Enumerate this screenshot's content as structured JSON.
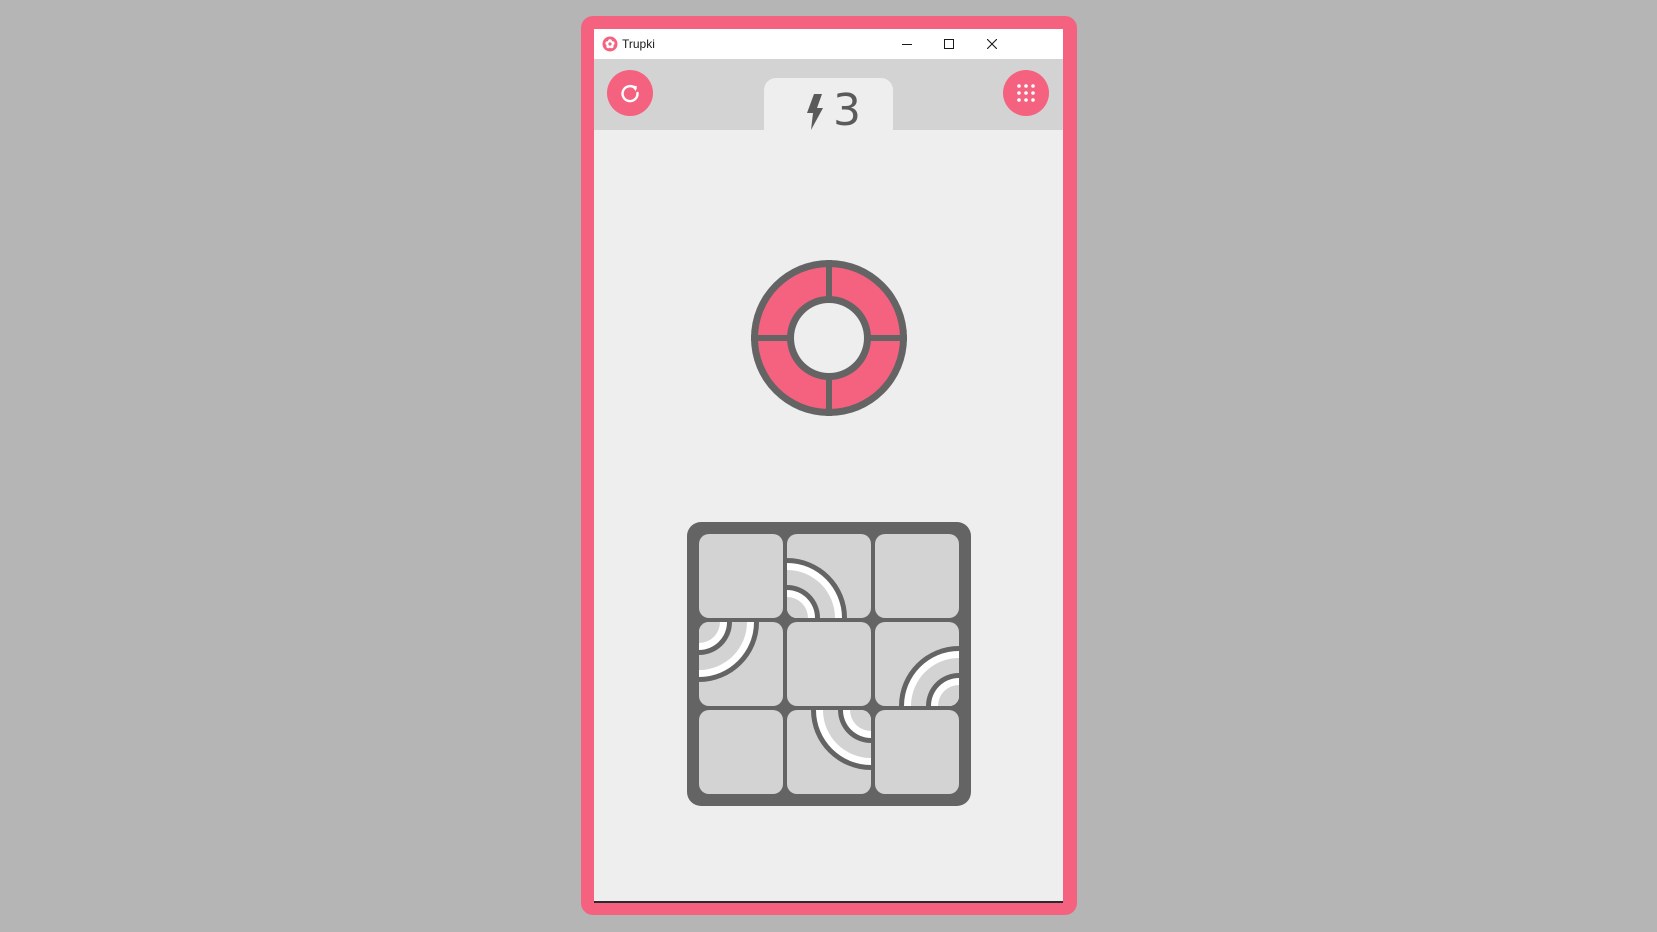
{
  "window": {
    "title": "Trupki",
    "icon": "flower-icon",
    "controls": [
      "minimize-icon",
      "maximize-icon",
      "close-icon"
    ]
  },
  "toolbar": {
    "restart_icon": "restart-icon",
    "menu_icon": "grid-menu-icon",
    "moves_icon": "lightning-icon",
    "moves_count": "3"
  },
  "colors": {
    "accent": "#f4627f",
    "pipe": "#646464",
    "tile": "#d3d3d3",
    "background": "#eeeeee",
    "page": "#b5b5b5"
  },
  "goal": {
    "shape": "ring",
    "quadrants": 4,
    "fill": "#f4627f"
  },
  "board": {
    "rows": 3,
    "cols": 3,
    "tiles": [
      {
        "row": 0,
        "col": 0,
        "pipe": "none"
      },
      {
        "row": 0,
        "col": 1,
        "pipe": "arc-bottom-left"
      },
      {
        "row": 0,
        "col": 2,
        "pipe": "none"
      },
      {
        "row": 1,
        "col": 0,
        "pipe": "arc-top-left"
      },
      {
        "row": 1,
        "col": 1,
        "pipe": "none"
      },
      {
        "row": 1,
        "col": 2,
        "pipe": "arc-bottom-right"
      },
      {
        "row": 2,
        "col": 0,
        "pipe": "none"
      },
      {
        "row": 2,
        "col": 1,
        "pipe": "arc-top-right"
      },
      {
        "row": 2,
        "col": 2,
        "pipe": "none"
      }
    ]
  }
}
